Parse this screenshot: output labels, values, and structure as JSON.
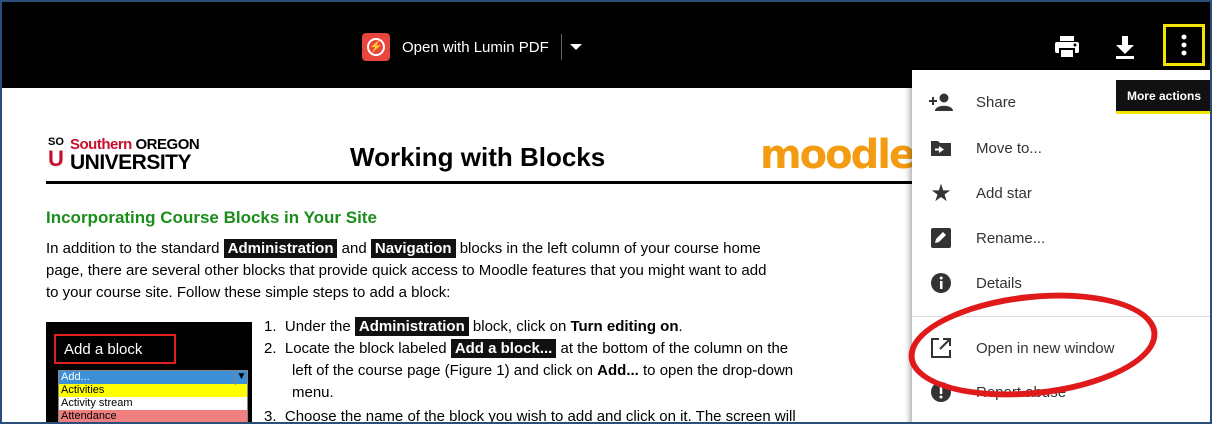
{
  "toolbar": {
    "open_with_label": "Open with Lumin PDF",
    "more_actions_tooltip": "More actions",
    "icons": {
      "lumin": "lumin-pdf-icon",
      "print": "print-icon",
      "download": "download-icon",
      "more": "more-vert-icon"
    }
  },
  "document": {
    "logo_so": "SO",
    "logo_u": "U",
    "logo_southern": "Southern",
    "logo_oregon": "OREGON",
    "logo_university": "UNIVERSITY",
    "title": "Working with Blocks",
    "moodle_logo": "moodle",
    "section_title": "Incorporating Course Blocks in Your Site",
    "para": {
      "l1_a": "In addition to the standard ",
      "l1_tag1": "Administration",
      "l1_b": " and ",
      "l1_tag2": "Navigation",
      "l1_c": " blocks in the left column of your course home",
      "l2": "page, there are several other blocks that provide quick access to Moodle features that you might want to add",
      "l3": "to your course site. Follow these simple steps to add a block:"
    },
    "figure": {
      "add_block_label": "Add a block",
      "options": [
        "Add...",
        "Activities",
        "Activity stream",
        "Attendance"
      ]
    },
    "steps": {
      "s1_num": "1.",
      "s1_a": "Under the ",
      "s1_tag": "Administration",
      "s1_b": " block, click on ",
      "s1_bold": "Turn editing on",
      "s1_c": ".",
      "s2_num": "2.",
      "s2_a": "Locate the block labeled ",
      "s2_tag": "Add a block...",
      "s2_b": " at the bottom of the column on the",
      "s2_l2_a": "left of the course page (Figure 1) and click on ",
      "s2_l2_bold": "Add...",
      "s2_l2_b": " to open the drop-down",
      "s2_l3": "menu.",
      "s3_num": "3.",
      "s3_a": "Choose the name of the block you wish to add and click on it. The screen will"
    }
  },
  "menu": {
    "items": [
      {
        "label": "Share",
        "icon": "person-add-icon"
      },
      {
        "label": "Move to...",
        "icon": "folder-move-icon"
      },
      {
        "label": "Add star",
        "icon": "star-icon"
      },
      {
        "label": "Rename...",
        "icon": "rename-icon"
      },
      {
        "label": "Details",
        "icon": "info-icon"
      },
      {
        "label": "Open in new window",
        "icon": "open-in-new-icon"
      },
      {
        "label": "Report abuse",
        "icon": "report-icon"
      }
    ]
  },
  "annotation_color": "#e01a1a",
  "highlight_color": "#f2e600"
}
